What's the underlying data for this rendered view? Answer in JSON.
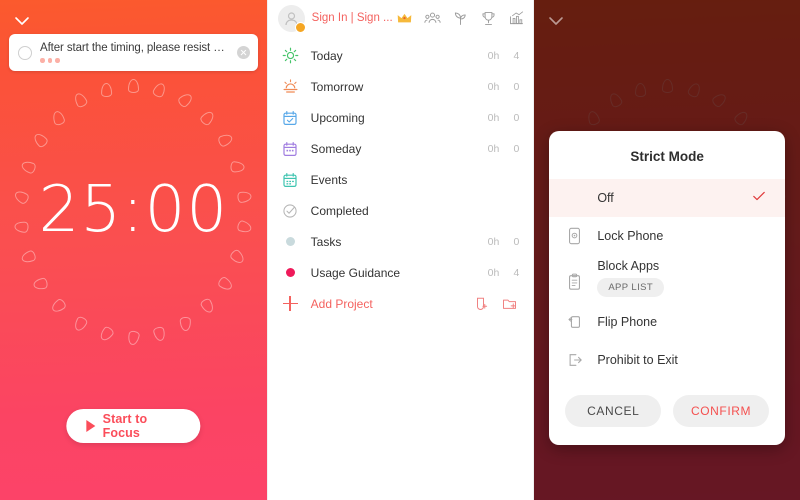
{
  "timer_panel": {
    "collapse_icon": "chevron-down-icon",
    "task": {
      "text": "After start the timing, please resist al...",
      "checkbox_state": "unchecked",
      "pomodoro_dots": 3,
      "close_icon": "close-circle-icon"
    },
    "time_display": "25:00",
    "start_button": {
      "label": "Start to Focus",
      "icon": "play-icon"
    },
    "colors": {
      "gradient_top": "#fb5a2d",
      "gradient_bottom": "#fc4369",
      "accent": "#fb4d5a"
    }
  },
  "list_panel": {
    "account": {
      "sign_in_label": "Sign In | Sign ...",
      "avatar_icon": "user-avatar-icon",
      "badge_icon": "coin-badge-icon"
    },
    "header_icons": [
      {
        "name": "crown-icon",
        "color": "#f6b93b"
      },
      {
        "name": "people-group-icon",
        "color": "#9a9a9a"
      },
      {
        "name": "sprout-icon",
        "color": "#9a9a9a"
      },
      {
        "name": "trophy-icon",
        "color": "#9a9a9a"
      },
      {
        "name": "bar-chart-icon",
        "color": "#9a9a9a"
      }
    ],
    "items": [
      {
        "label": "Today",
        "hours": "0h",
        "count": "4",
        "icon": "sun-icon",
        "color": "#46c46a"
      },
      {
        "label": "Tomorrow",
        "hours": "0h",
        "count": "0",
        "icon": "sunrise-icon",
        "color": "#f08a55"
      },
      {
        "label": "Upcoming",
        "hours": "0h",
        "count": "0",
        "icon": "calendar-check-icon",
        "color": "#58a8e8"
      },
      {
        "label": "Someday",
        "hours": "0h",
        "count": "0",
        "icon": "calendar-icon",
        "color": "#a07de0"
      },
      {
        "label": "Events",
        "hours": "",
        "count": "",
        "icon": "calendar-event-icon",
        "color": "#3ec4b0"
      },
      {
        "label": "Completed",
        "hours": "",
        "count": "",
        "icon": "check-circle-icon",
        "color": "#b6b6b6"
      },
      {
        "label": "Tasks",
        "hours": "0h",
        "count": "0",
        "icon": "dot-icon",
        "color": "#c9dadd"
      },
      {
        "label": "Usage Guidance",
        "hours": "0h",
        "count": "4",
        "icon": "dot-icon",
        "color": "#ef1a5a"
      }
    ],
    "add_project": {
      "label": "Add Project",
      "plus_icon": "plus-icon",
      "actions": [
        {
          "name": "add-tag-icon"
        },
        {
          "name": "add-folder-icon"
        }
      ]
    }
  },
  "modal_panel": {
    "collapse_icon": "chevron-down-icon",
    "dialog": {
      "title": "Strict Mode",
      "options": [
        {
          "label": "Off",
          "icon": "",
          "selected": true,
          "check_icon": "check-icon"
        },
        {
          "label": "Lock Phone",
          "icon": "lock-phone-icon",
          "selected": false
        },
        {
          "label": "Block Apps",
          "icon": "clipboard-icon",
          "selected": false,
          "chip": "APP LIST"
        },
        {
          "label": "Flip Phone",
          "icon": "flip-phone-icon",
          "selected": false
        },
        {
          "label": "Prohibit to Exit",
          "icon": "exit-icon",
          "selected": false
        }
      ],
      "cancel_label": "CANCEL",
      "confirm_label": "CONFIRM",
      "confirm_color": "#f4504f"
    }
  }
}
